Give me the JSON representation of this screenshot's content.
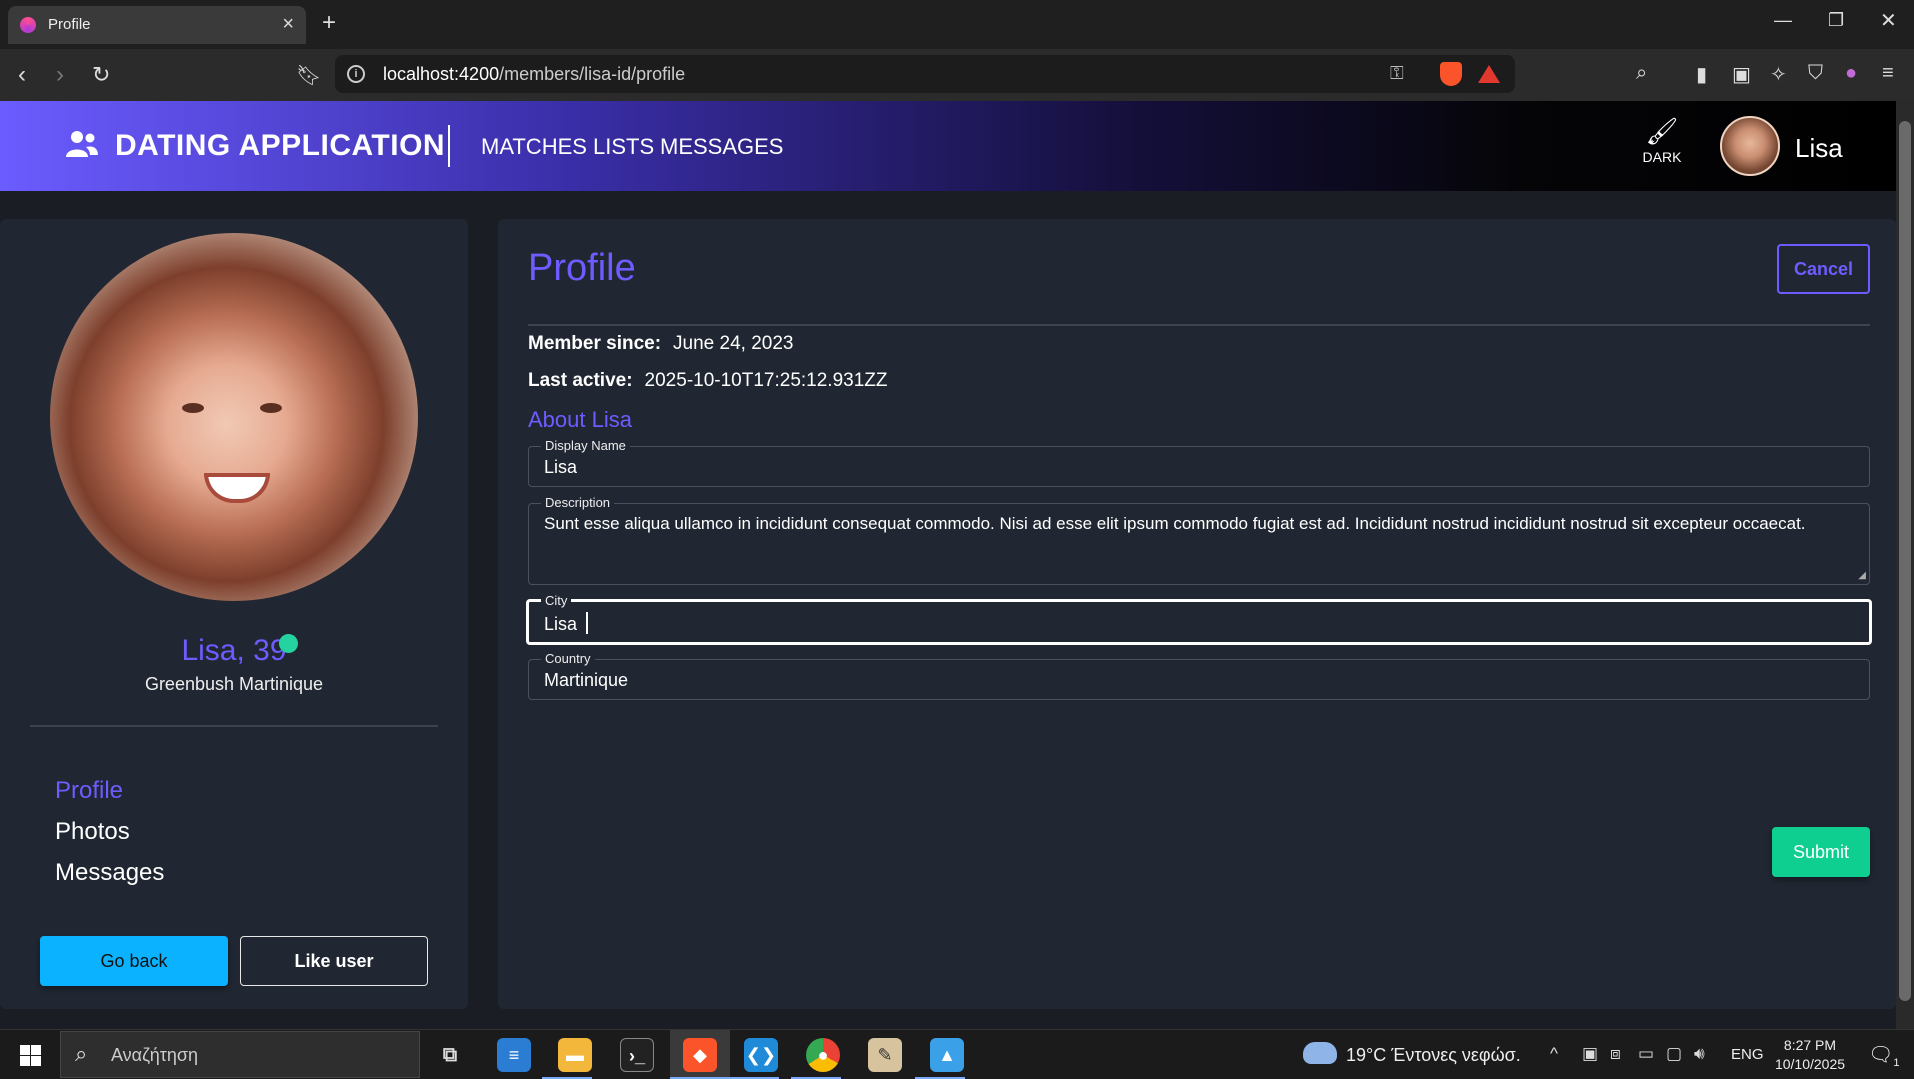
{
  "browser": {
    "tab_title": "Profile",
    "url_host": "localhost:4200",
    "url_path": "/members/lisa-id/profile"
  },
  "navbar": {
    "brand": "DATING APPLICATION",
    "links": [
      "MATCHES",
      "LISTS",
      "MESSAGES"
    ],
    "theme_label": "DARK",
    "user_name": "Lisa"
  },
  "member": {
    "name_age": "Lisa, 39",
    "location": "Greenbush Martinique",
    "online": true,
    "side_links": [
      "Profile",
      "Photos",
      "Messages"
    ],
    "active_link": "Profile",
    "go_back_label": "Go back",
    "like_label": "Like user"
  },
  "profile": {
    "title": "Profile",
    "cancel_label": "Cancel",
    "member_since_label": "Member since:",
    "member_since_value": "June 24, 2023",
    "last_active_label": "Last active:",
    "last_active_value": "2025-10-10T17:25:12.931ZZ",
    "about_title": "About Lisa",
    "fields": {
      "display_name": {
        "label": "Display Name",
        "value": "Lisa"
      },
      "description": {
        "label": "Description",
        "value": "Sunt esse aliqua ullamco in incididunt consequat commodo. Nisi ad esse elit ipsum commodo fugiat est ad. Incididunt nostrud incididunt nostrud sit excepteur occaecat."
      },
      "city": {
        "label": "City",
        "value": "Lisa "
      },
      "country": {
        "label": "Country",
        "value": "Martinique"
      }
    },
    "submit_label": "Submit"
  },
  "taskbar": {
    "search_placeholder": "Αναζήτηση",
    "weather": "19°C  Έντονες νεφώσ.",
    "language": "ENG",
    "time": "8:27 PM",
    "date": "10/10/2025",
    "notification_count": "1"
  },
  "colors": {
    "accent": "#6d5cff",
    "online": "#24d3a0",
    "go_back": "#0ab2ff",
    "submit": "#0ecf8f"
  }
}
